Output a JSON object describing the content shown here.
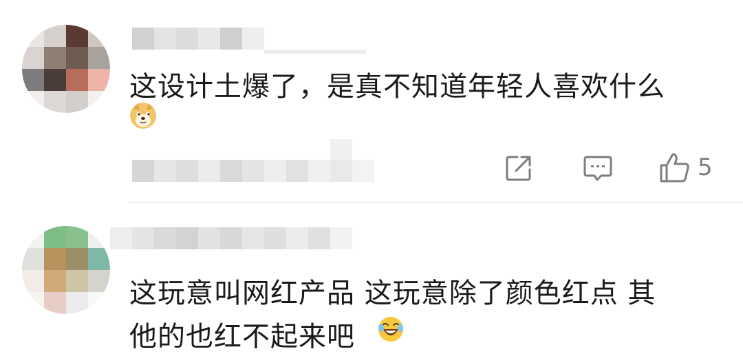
{
  "comments": [
    {
      "text": "这设计土爆了，是真不知道年轻人喜欢什么",
      "emoji": "doge-icon",
      "actions": {
        "like_count": "5"
      }
    },
    {
      "line1": "这玩意叫网红产品 这玩意除了颜色红点 其",
      "line2": "他的也红不起来吧",
      "emoji": "laugh-cry-icon"
    }
  ],
  "colors": {
    "text": "#1a1a1a",
    "icon": "#7d7d7d",
    "divider": "#ececec"
  }
}
